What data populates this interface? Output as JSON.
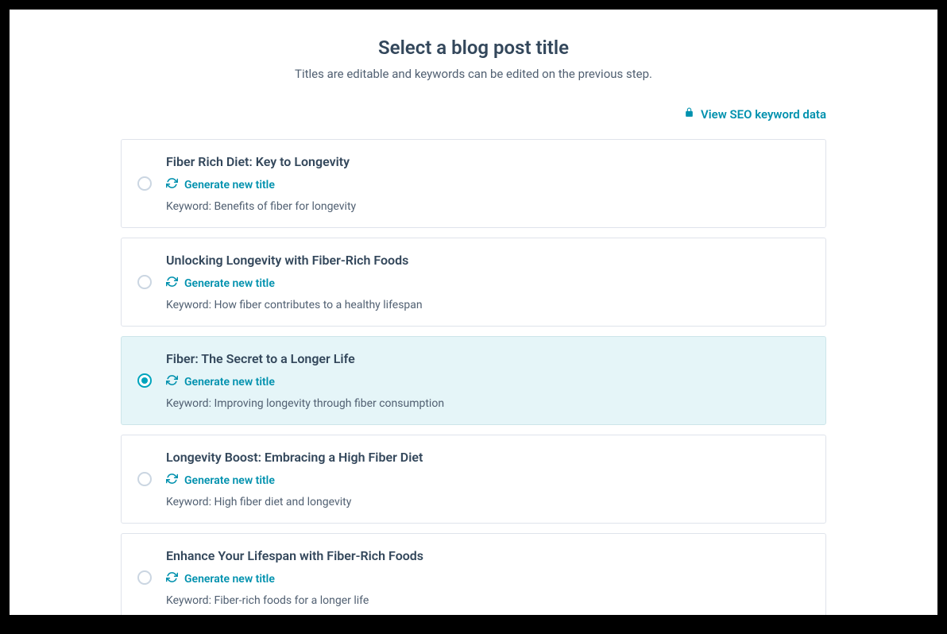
{
  "header": {
    "title": "Select a blog post title",
    "subtitle": "Titles are editable and keywords can be edited on the previous step."
  },
  "seo_link_label": "View SEO keyword data",
  "generate_label": "Generate new title",
  "keyword_prefix": "Keyword: ",
  "selected_index": 2,
  "options": [
    {
      "title": "Fiber Rich Diet: Key to Longevity",
      "keyword": "Benefits of fiber for longevity"
    },
    {
      "title": "Unlocking Longevity with Fiber-Rich Foods",
      "keyword": "How fiber contributes to a healthy lifespan"
    },
    {
      "title": "Fiber: The Secret to a Longer Life",
      "keyword": "Improving longevity through fiber consumption"
    },
    {
      "title": "Longevity Boost: Embracing a High Fiber Diet",
      "keyword": "High fiber diet and longevity"
    },
    {
      "title": "Enhance Your Lifespan with Fiber-Rich Foods",
      "keyword": "Fiber-rich foods for a longer life"
    }
  ]
}
